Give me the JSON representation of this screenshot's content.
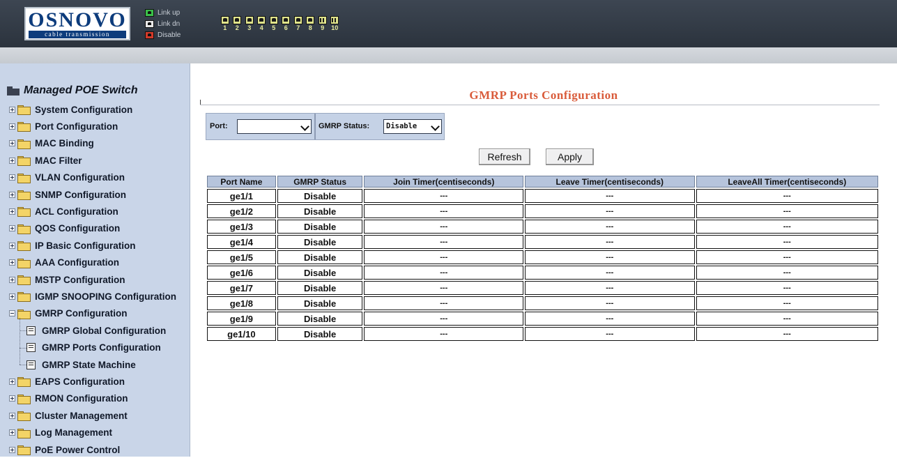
{
  "header": {
    "logo_brand": "OSNOVO",
    "logo_sub": "cable transmission",
    "legend": [
      {
        "label": "Link up",
        "color": "#3bbf4a"
      },
      {
        "label": "Link dn",
        "color": "#e8e8e8"
      },
      {
        "label": "Disable",
        "color": "#d23a2a"
      }
    ],
    "ports": [
      "1",
      "2",
      "3",
      "4",
      "5",
      "6",
      "7",
      "8",
      "9",
      "10"
    ]
  },
  "sidebar": {
    "root": "Managed POE Switch",
    "items": [
      {
        "label": "System Configuration",
        "expanded": false
      },
      {
        "label": "Port Configuration",
        "expanded": false
      },
      {
        "label": "MAC Binding",
        "expanded": false
      },
      {
        "label": "MAC Filter",
        "expanded": false
      },
      {
        "label": "VLAN Configuration",
        "expanded": false
      },
      {
        "label": "SNMP Configuration",
        "expanded": false
      },
      {
        "label": "ACL Configuration",
        "expanded": false
      },
      {
        "label": "QOS Configuration",
        "expanded": false
      },
      {
        "label": "IP Basic Configuration",
        "expanded": false
      },
      {
        "label": "AAA Configuration",
        "expanded": false
      },
      {
        "label": "MSTP Configuration",
        "expanded": false
      },
      {
        "label": "IGMP SNOOPING Configuration",
        "expanded": false
      },
      {
        "label": "GMRP Configuration",
        "expanded": true
      },
      {
        "label": "GMRP Global Configuration",
        "child": true
      },
      {
        "label": "GMRP Ports Configuration",
        "child": true
      },
      {
        "label": "GMRP State Machine",
        "child": true
      },
      {
        "label": "EAPS Configuration",
        "expanded": false
      },
      {
        "label": "RMON Configuration",
        "expanded": false
      },
      {
        "label": "Cluster Management",
        "expanded": false
      },
      {
        "label": "Log Management",
        "expanded": false
      },
      {
        "label": "PoE Power Control",
        "expanded": false
      }
    ]
  },
  "main": {
    "title": "GMRP Ports Configuration",
    "filter": {
      "port_label": "Port:",
      "port_value": "",
      "status_label": "GMRP Status:",
      "status_value": "Disable"
    },
    "refresh_label": "Refresh",
    "apply_label": "Apply",
    "table": {
      "headers": [
        "Port Name",
        "GMRP Status",
        "Join Timer(centiseconds)",
        "Leave Timer(centiseconds)",
        "LeaveAll Timer(centiseconds)"
      ],
      "rows": [
        [
          "ge1/1",
          "Disable",
          "---",
          "---",
          "---"
        ],
        [
          "ge1/2",
          "Disable",
          "---",
          "---",
          "---"
        ],
        [
          "ge1/3",
          "Disable",
          "---",
          "---",
          "---"
        ],
        [
          "ge1/4",
          "Disable",
          "---",
          "---",
          "---"
        ],
        [
          "ge1/5",
          "Disable",
          "---",
          "---",
          "---"
        ],
        [
          "ge1/6",
          "Disable",
          "---",
          "---",
          "---"
        ],
        [
          "ge1/7",
          "Disable",
          "---",
          "---",
          "---"
        ],
        [
          "ge1/8",
          "Disable",
          "---",
          "---",
          "---"
        ],
        [
          "ge1/9",
          "Disable",
          "---",
          "---",
          "---"
        ],
        [
          "ge1/10",
          "Disable",
          "---",
          "---",
          "---"
        ]
      ]
    }
  }
}
